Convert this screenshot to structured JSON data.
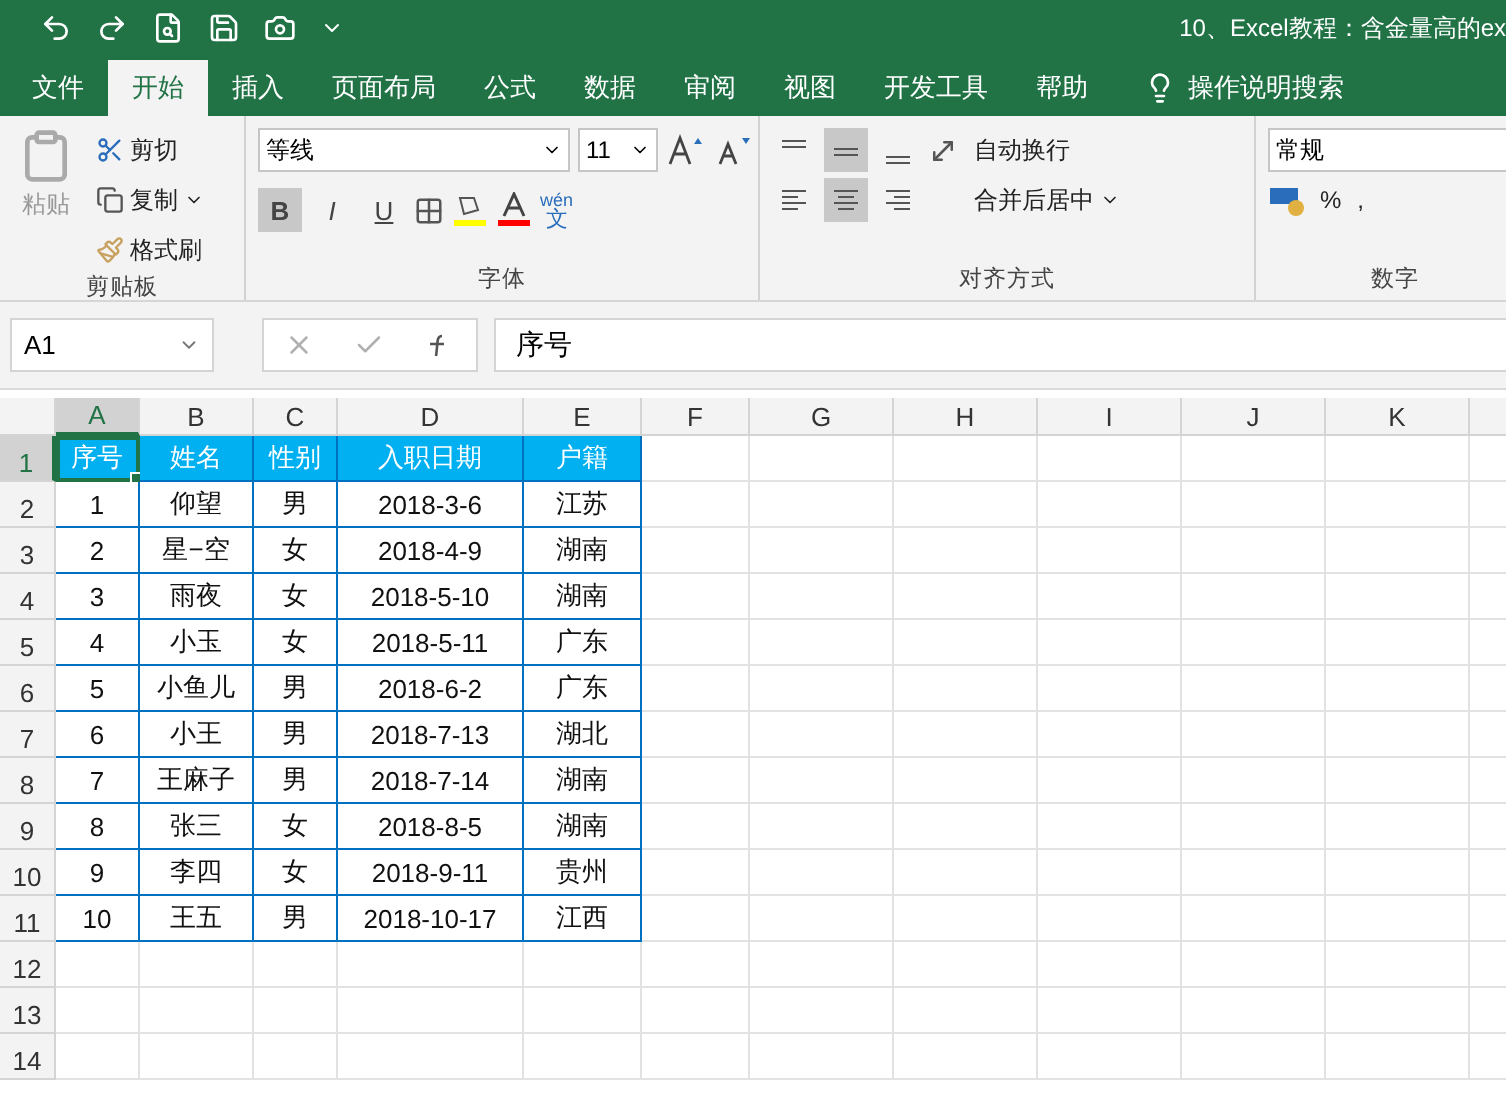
{
  "window": {
    "title": "10、Excel教程：含金量高的ex"
  },
  "tabs": [
    {
      "label": "文件",
      "selected": false
    },
    {
      "label": "开始",
      "selected": true
    },
    {
      "label": "插入",
      "selected": false
    },
    {
      "label": "页面布局",
      "selected": false
    },
    {
      "label": "公式",
      "selected": false
    },
    {
      "label": "数据",
      "selected": false
    },
    {
      "label": "审阅",
      "selected": false
    },
    {
      "label": "视图",
      "selected": false
    },
    {
      "label": "开发工具",
      "selected": false
    },
    {
      "label": "帮助",
      "selected": false
    }
  ],
  "tell_me": {
    "placeholder": "操作说明搜索"
  },
  "ribbon": {
    "clipboard": {
      "label": "剪贴板",
      "paste": "粘贴",
      "cut": "剪切",
      "copy": "复制",
      "format_painter": "格式刷"
    },
    "font": {
      "label": "字体",
      "font_name": "等线",
      "font_size": "11",
      "bold": {
        "label": "B",
        "selected": true
      },
      "italic": {
        "label": "I",
        "selected": false
      },
      "underline": {
        "label": "U",
        "selected": false
      },
      "phonetic_top": "wén",
      "phonetic_bottom": "文"
    },
    "alignment": {
      "label": "对齐方式",
      "vertical": [
        {
          "selected": false
        },
        {
          "selected": true
        },
        {
          "selected": false
        }
      ],
      "horizontal": [
        {
          "selected": false
        },
        {
          "selected": true
        },
        {
          "selected": false
        }
      ],
      "wrap_text": "自动换行",
      "merge_center": "合并后居中"
    },
    "number": {
      "label": "数字",
      "format": "常规",
      "percent": "%",
      "comma": ","
    }
  },
  "formula_bar": {
    "name_box": "A1",
    "value": "序号"
  },
  "columns": [
    {
      "label": "A",
      "selected": true
    },
    {
      "label": "B",
      "selected": false
    },
    {
      "label": "C",
      "selected": false
    },
    {
      "label": "D",
      "selected": false
    },
    {
      "label": "E",
      "selected": false
    },
    {
      "label": "F",
      "selected": false
    },
    {
      "label": "G",
      "selected": false
    },
    {
      "label": "H",
      "selected": false
    },
    {
      "label": "I",
      "selected": false
    },
    {
      "label": "J",
      "selected": false
    },
    {
      "label": "K",
      "selected": false
    }
  ],
  "rows": [
    {
      "label": "1",
      "selected": true
    },
    {
      "label": "2",
      "selected": false
    },
    {
      "label": "3",
      "selected": false
    },
    {
      "label": "4",
      "selected": false
    },
    {
      "label": "5",
      "selected": false
    },
    {
      "label": "6",
      "selected": false
    },
    {
      "label": "7",
      "selected": false
    },
    {
      "label": "8",
      "selected": false
    },
    {
      "label": "9",
      "selected": false
    },
    {
      "label": "10",
      "selected": false
    },
    {
      "label": "11",
      "selected": false
    },
    {
      "label": "12",
      "selected": false
    },
    {
      "label": "13",
      "selected": false
    },
    {
      "label": "14",
      "selected": false
    }
  ],
  "table": {
    "header": [
      "序号",
      "姓名",
      "性别",
      "入职日期",
      "户籍"
    ],
    "rows": [
      [
        "1",
        "仰望",
        "男",
        "2018-3-6",
        "江苏"
      ],
      [
        "2",
        "星−空",
        "女",
        "2018-4-9",
        "湖南"
      ],
      [
        "3",
        "雨夜",
        "女",
        "2018-5-10",
        "湖南"
      ],
      [
        "4",
        "小玉",
        "女",
        "2018-5-11",
        "广东"
      ],
      [
        "5",
        "小鱼儿",
        "男",
        "2018-6-2",
        "广东"
      ],
      [
        "6",
        "小王",
        "男",
        "2018-7-13",
        "湖北"
      ],
      [
        "7",
        "王麻子",
        "男",
        "2018-7-14",
        "湖南"
      ],
      [
        "8",
        "张三",
        "女",
        "2018-8-5",
        "湖南"
      ],
      [
        "9",
        "李四",
        "女",
        "2018-9-11",
        "贵州"
      ],
      [
        "10",
        "王五",
        "男",
        "2018-10-17",
        "江西"
      ]
    ]
  }
}
